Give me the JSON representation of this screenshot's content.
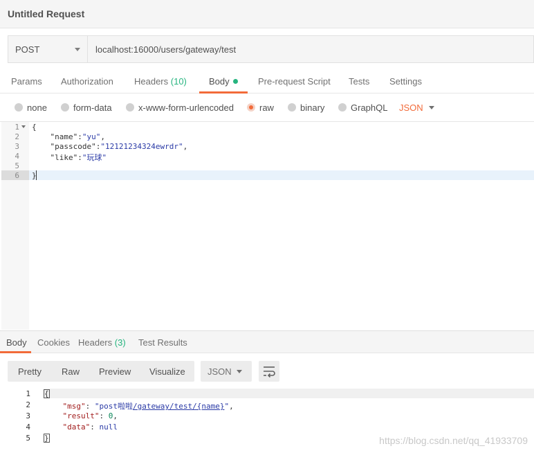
{
  "window": {
    "title": "Untitled Request"
  },
  "request": {
    "method": "POST",
    "url": "localhost:16000/users/gateway/test"
  },
  "request_tabs": {
    "params": "Params",
    "authorization": "Authorization",
    "headers": "Headers",
    "headers_count": "(10)",
    "body": "Body",
    "prerequest": "Pre-request Script",
    "tests": "Tests",
    "settings": "Settings",
    "active": "Body"
  },
  "body_modes": {
    "none": "none",
    "form_data": "form-data",
    "urlencoded": "x-www-form-urlencoded",
    "raw": "raw",
    "binary": "binary",
    "graphql": "GraphQL",
    "selected": "raw",
    "format": "JSON"
  },
  "request_editor": {
    "line_numbers": [
      "1",
      "2",
      "3",
      "4",
      "5",
      "6"
    ],
    "lines": {
      "l1": "{",
      "l2_key": "\"name\"",
      "l2_rest": ":",
      "l2_val": "\"yu\"",
      "l2_end": ",",
      "l3_key": "\"passcode\"",
      "l3_rest": ":",
      "l3_val": "\"12121234324ewrdr\"",
      "l3_end": ",",
      "l4_key": "\"like\"",
      "l4_rest": ":",
      "l4_val": "\"玩球\"",
      "l5": "",
      "l6": "}"
    },
    "active_line": "6"
  },
  "response_tabs": {
    "body": "Body",
    "cookies": "Cookies",
    "headers": "Headers",
    "headers_count": "(3)",
    "test_results": "Test Results",
    "active": "Body"
  },
  "response_toolbar": {
    "pretty": "Pretty",
    "raw": "Raw",
    "preview": "Preview",
    "visualize": "Visualize",
    "format": "JSON",
    "wrap_icon": "wrap-lines-icon"
  },
  "response_body": {
    "line_numbers": [
      "1",
      "2",
      "3",
      "4",
      "5"
    ],
    "l1": "{",
    "msg_key": "\"msg\"",
    "msg_val_prefix": "\"post啦啦",
    "msg_val_link": "/gateway/test/{name}",
    "msg_val_suffix": "\"",
    "result_key": "\"result\"",
    "result_val": "0",
    "data_key": "\"data\"",
    "data_val": "null",
    "l5": "}"
  },
  "watermark": "https://blog.csdn.net/qq_41933709",
  "colors": {
    "accent": "#f26b3a",
    "count_green": "#26b47f"
  }
}
